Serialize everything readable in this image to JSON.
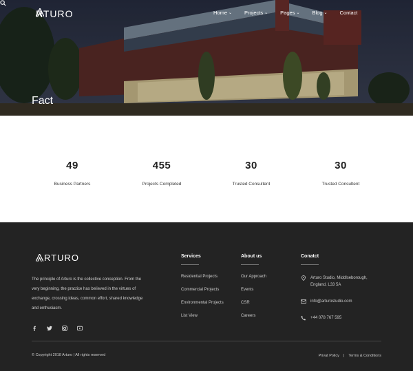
{
  "brand": {
    "name": "RTURO"
  },
  "nav": {
    "items": [
      {
        "label": "Home",
        "has_dropdown": true
      },
      {
        "label": "Projects",
        "has_dropdown": true
      },
      {
        "label": "Pages",
        "has_dropdown": true
      },
      {
        "label": "Blog",
        "has_dropdown": true
      },
      {
        "label": "Contact",
        "has_dropdown": false
      }
    ],
    "search_icon": "search-icon"
  },
  "hero": {
    "title": "Fact"
  },
  "facts": [
    {
      "number": "49",
      "label": "Business Partners"
    },
    {
      "number": "455",
      "label": "Projects Completed"
    },
    {
      "number": "30",
      "label": "Trusted Consultent"
    },
    {
      "number": "30",
      "label": "Trusted Consultent"
    }
  ],
  "footer": {
    "brand": "RTURO",
    "about": "The principle of Arturo is the collective conception. From the very beginning, the practice has believed in the virtues of exchange, crossing ideas, common effort, shared knowledge and enthusiasm.",
    "social": [
      "facebook-icon",
      "twitter-icon",
      "instagram-icon",
      "youtube-icon"
    ],
    "services": {
      "title": "Services",
      "items": [
        "Residential Projects",
        "Commercial Projects",
        "Environmental Projects",
        "List View"
      ]
    },
    "about_us": {
      "title": "About us",
      "items": [
        "Our Approach",
        "Events",
        "CSR",
        "Careers"
      ]
    },
    "contact": {
      "title": "Conatct",
      "address": "Arturo Studio, Middlseborough, England, L33 5A",
      "email": "info@arturostudio.com",
      "phone": "+44 078 767 595"
    },
    "copyright": "© Copyright 2018 Arturo | All rights reserved",
    "privacy": "Privat Policy",
    "separator": "|",
    "terms": "Terms & Conditions"
  },
  "colors": {
    "footer_bg": "#232323",
    "hero_overlay": "#2b3246",
    "text_white": "#ffffff"
  }
}
